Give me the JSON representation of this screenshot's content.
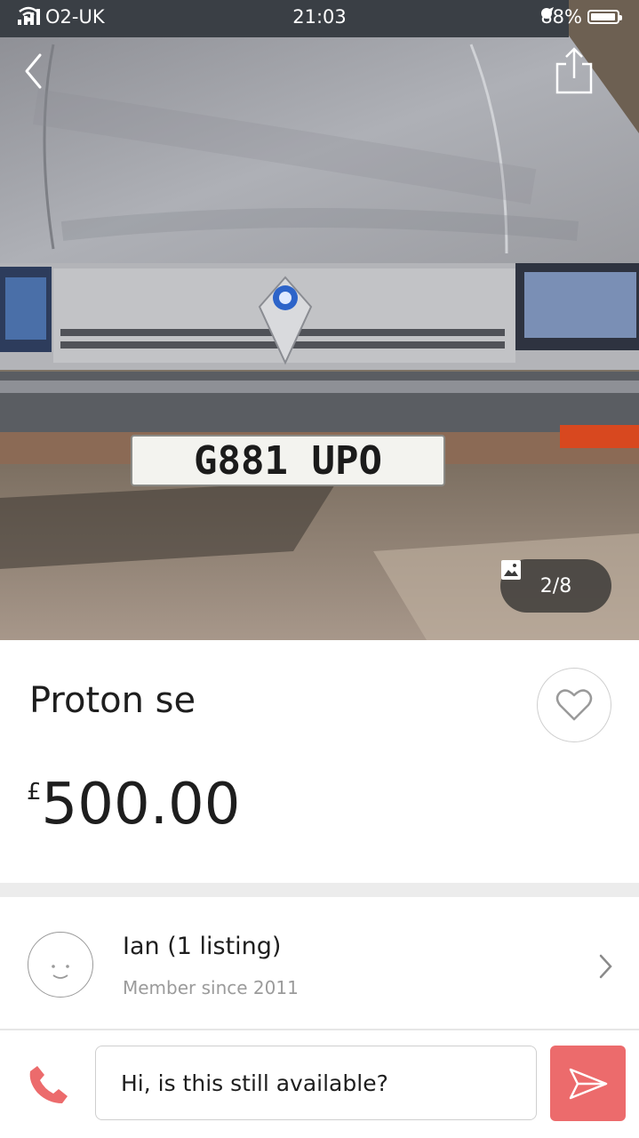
{
  "status_bar": {
    "carrier": "O2-UK",
    "time": "21:03",
    "battery": "88%"
  },
  "photo": {
    "plate_text": "G881 UPO",
    "counter": "2/8"
  },
  "listing": {
    "title": "Proton se",
    "currency_symbol": "£",
    "price": "500.00"
  },
  "seller": {
    "name": "Ian (1 listing)",
    "member_since": "Member since 2011"
  },
  "message": {
    "value": "Hi, is this still available?"
  },
  "colors": {
    "accent": "#ec6b6c",
    "divider": "#ececec",
    "muted_text": "#9b9b9b"
  },
  "icons": [
    "back-icon",
    "share-icon",
    "image-icon",
    "heart-icon",
    "avatar-face-icon",
    "chevron-right-icon",
    "phone-icon",
    "send-icon",
    "wifi-icon",
    "location-icon",
    "battery-icon"
  ]
}
